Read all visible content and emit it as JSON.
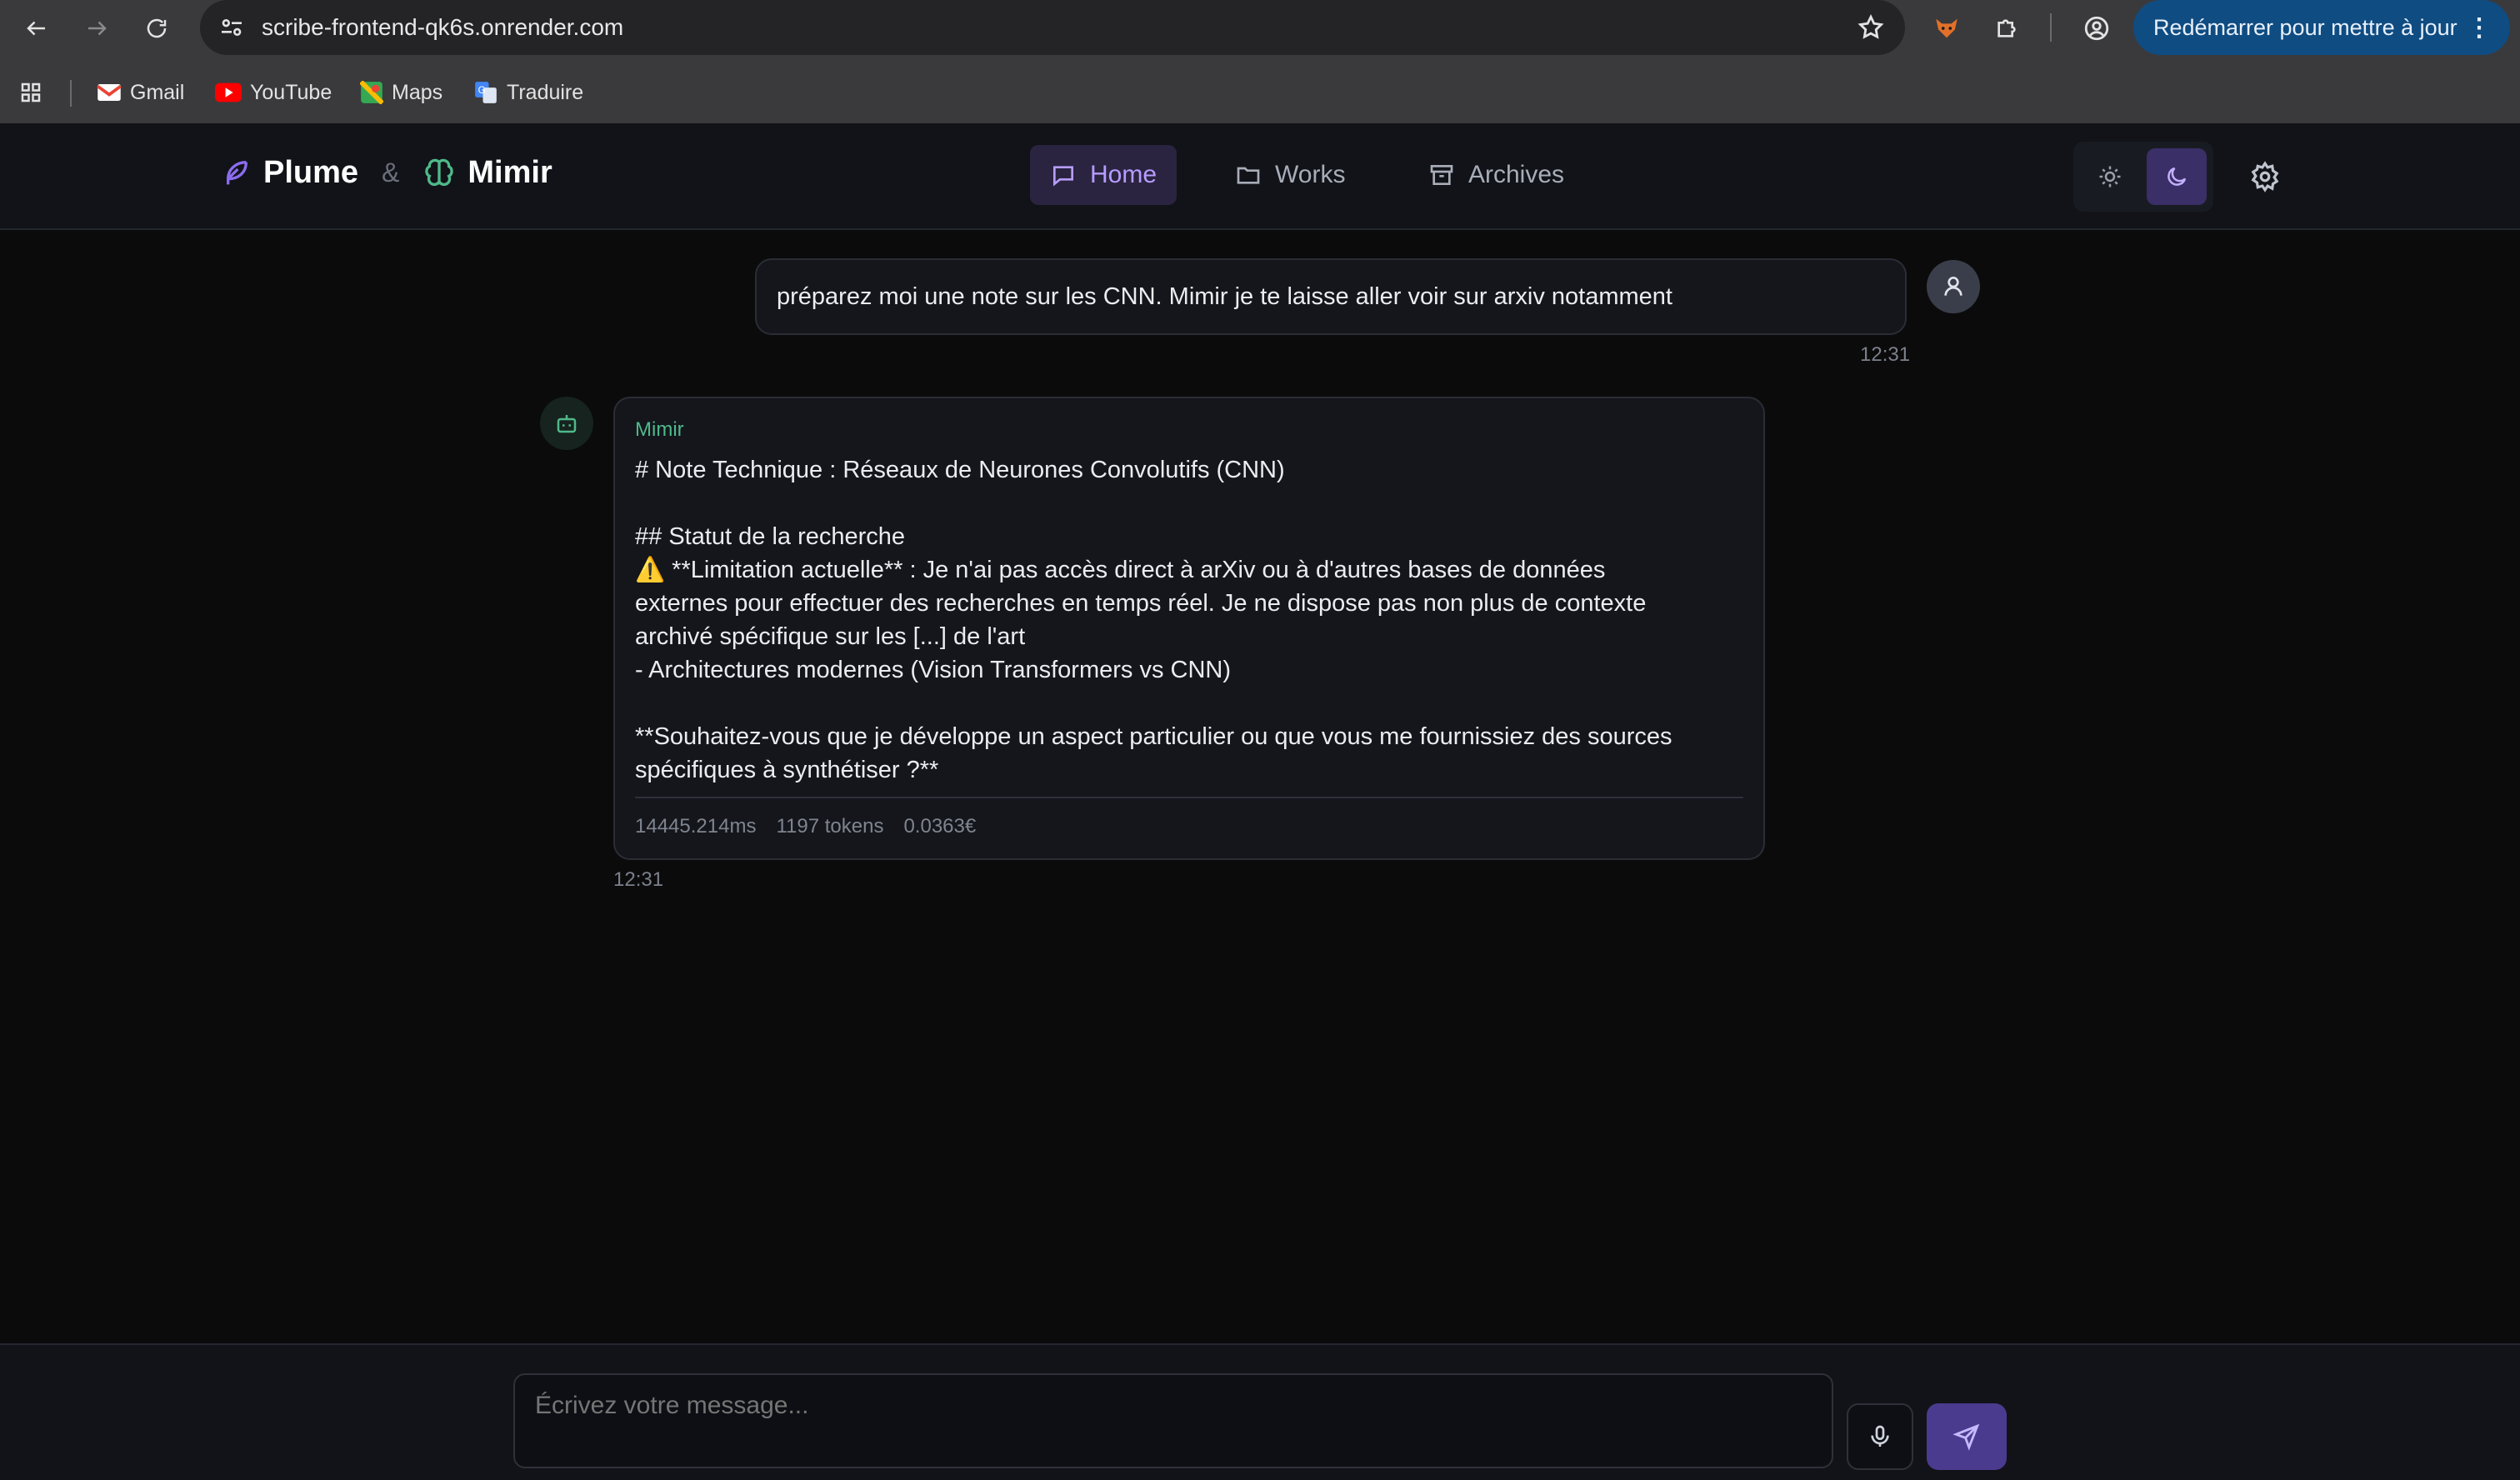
{
  "browser": {
    "url": "scribe-frontend-qk6s.onrender.com",
    "update_button": "Redémarrer pour mettre à jour",
    "bookmarks": [
      {
        "label": "Gmail",
        "icon": "gmail-icon"
      },
      {
        "label": "YouTube",
        "icon": "youtube-icon"
      },
      {
        "label": "Maps",
        "icon": "maps-icon"
      },
      {
        "label": "Traduire",
        "icon": "translate-icon"
      }
    ]
  },
  "header": {
    "brand_1": "Plume",
    "brand_sep": "&",
    "brand_2": "Mimir",
    "nav": [
      {
        "label": "Home",
        "icon": "chat-icon",
        "active": true
      },
      {
        "label": "Works",
        "icon": "folder-icon",
        "active": false
      },
      {
        "label": "Archives",
        "icon": "archive-icon",
        "active": false
      }
    ],
    "theme_active": "dark"
  },
  "conversation": {
    "user_message": {
      "text": "préparez moi une note sur les CNN. Mimir je te laisse aller voir sur arxiv notamment",
      "time": "12:31"
    },
    "bot_message": {
      "author": "Mimir",
      "lines": [
        "# Note Technique : Réseaux de Neurones Convolutifs (CNN)",
        "",
        "## Statut de la recherche",
        "⚠️ **Limitation actuelle** : Je n'ai pas accès direct à arXiv ou à d'autres bases de données",
        "externes pour effectuer des recherches en temps réel. Je ne dispose pas non plus de contexte",
        "archivé spécifique sur les [...] de l'art",
        "- Architectures modernes (Vision Transformers vs CNN)",
        "",
        "**Souhaitez-vous que je développe un aspect particulier ou que vous me fournissiez des sources",
        "spécifiques à synthétiser ?**"
      ],
      "duration": "14445.214ms",
      "tokens": "1197 tokens",
      "cost": "0.0363€",
      "time": "12:31"
    }
  },
  "composer": {
    "placeholder": "Écrivez votre message..."
  },
  "colors": {
    "accent": "#b79cff",
    "bot_accent": "#4fb98a",
    "send_bg": "#4a3b8f"
  }
}
